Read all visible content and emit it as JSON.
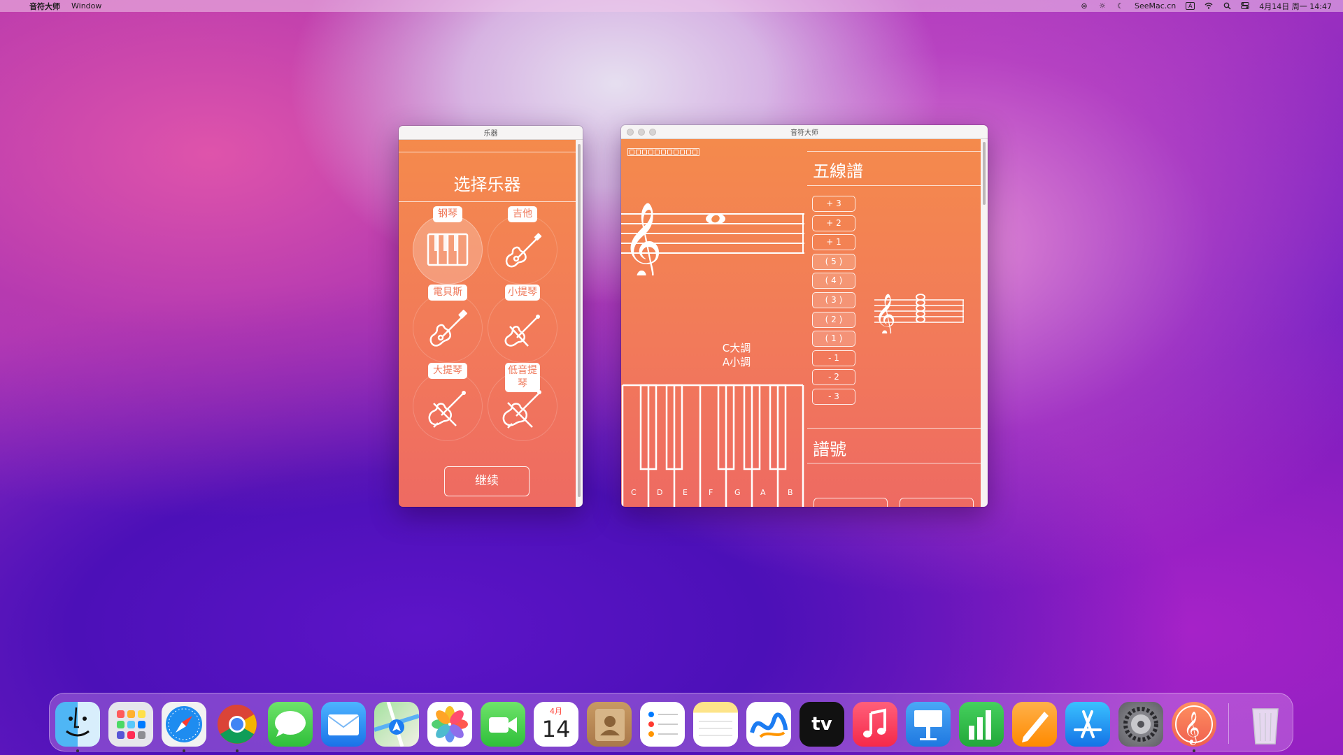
{
  "menubar": {
    "apple": "",
    "app_name": "音符大师",
    "menu_window": "Window",
    "seemac": "SeeMac.cn",
    "input_source": "A",
    "datetime": "4月14日 周一  14:47"
  },
  "instrument_window": {
    "title": "乐器",
    "heading": "选择乐器",
    "instruments": [
      {
        "label": "钢琴",
        "selected": true
      },
      {
        "label": "吉他",
        "selected": false
      },
      {
        "label": "電貝斯",
        "selected": false
      },
      {
        "label": "小提琴",
        "selected": false
      },
      {
        "label": "大提琴",
        "selected": false
      },
      {
        "label": "低音提琴",
        "selected": false
      }
    ],
    "continue_label": "继续"
  },
  "main_window": {
    "title": "音符大师",
    "tofu_text": "□□□□□□□□□□□",
    "key_major": "C大調",
    "key_minor": "A小調",
    "piano_keys": [
      "C",
      "D",
      "E",
      "F",
      "G",
      "A",
      "B"
    ],
    "staff_title": "五線譜",
    "steps": [
      "+ 3",
      "+ 2",
      "+ 1",
      "( 5 )",
      "( 4 )",
      "( 3 )",
      "( 2 )",
      "( 1 )",
      "- 1",
      "- 2",
      "- 3"
    ],
    "signature_title": "譜號"
  },
  "dock": {
    "calendar_month": "4月",
    "calendar_day": "14",
    "tv_label": "tv",
    "apps": [
      "finder",
      "launchpad",
      "safari",
      "chrome",
      "messages",
      "mail",
      "maps",
      "photos",
      "facetime",
      "calendar",
      "contacts",
      "reminders",
      "notes",
      "freeform",
      "tv",
      "music",
      "keynote",
      "numbers",
      "pages",
      "app-store",
      "system-settings",
      "note-master",
      "trash"
    ]
  },
  "colors": {
    "window_gradient_top": "#f48a4c",
    "window_gradient_bottom": "#ee6a62",
    "label_text": "#ef7a5c"
  }
}
